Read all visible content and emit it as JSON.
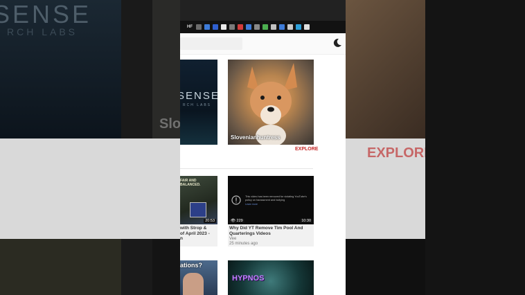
{
  "background": {
    "brand_text": "SENSE",
    "brand_sub": "RCH LABS",
    "explore": "EXPLORE",
    "side_text": "Slo"
  },
  "taskbar": {
    "label": "HF",
    "icon_colors": [
      "#6b6b6b",
      "#3d7bd8",
      "#2f5fd0",
      "#e8e8e8",
      "#7a7a7a",
      "#d23b3b",
      "#3d7bd8",
      "#888",
      "#4caf50",
      "#c0c0c0",
      "#3d7bd8",
      "#c8c8c8",
      "#2b9ed8",
      "#e0e0e0"
    ]
  },
  "header": {
    "theme_icon": "moon-icon"
  },
  "featured": {
    "left_brand": "SENSE",
    "left_brand_sub": "RCH LABS",
    "right_name": "Slovenianhuntress",
    "explore_label": "EXPLORE"
  },
  "videos": [
    {
      "title_lines": [
        "with Strop &",
        "of April 2023 -",
        "n"
      ],
      "duration": "20:53",
      "overlay": "FAIR AND BALANCED."
    },
    {
      "title": "Why Did YT Remove Tim Pool And Quarterings Videos",
      "channel": "Vee",
      "time_ago": "25 minutes ago",
      "views": "229",
      "duration": "10:30",
      "removed_notice": "This video has been removed for violating YouTube's policy on harassment and bullying",
      "removed_link": "Learn more"
    }
  ],
  "bottom_cards": {
    "left_text": "ations?",
    "right_text": "HYPNOS"
  }
}
